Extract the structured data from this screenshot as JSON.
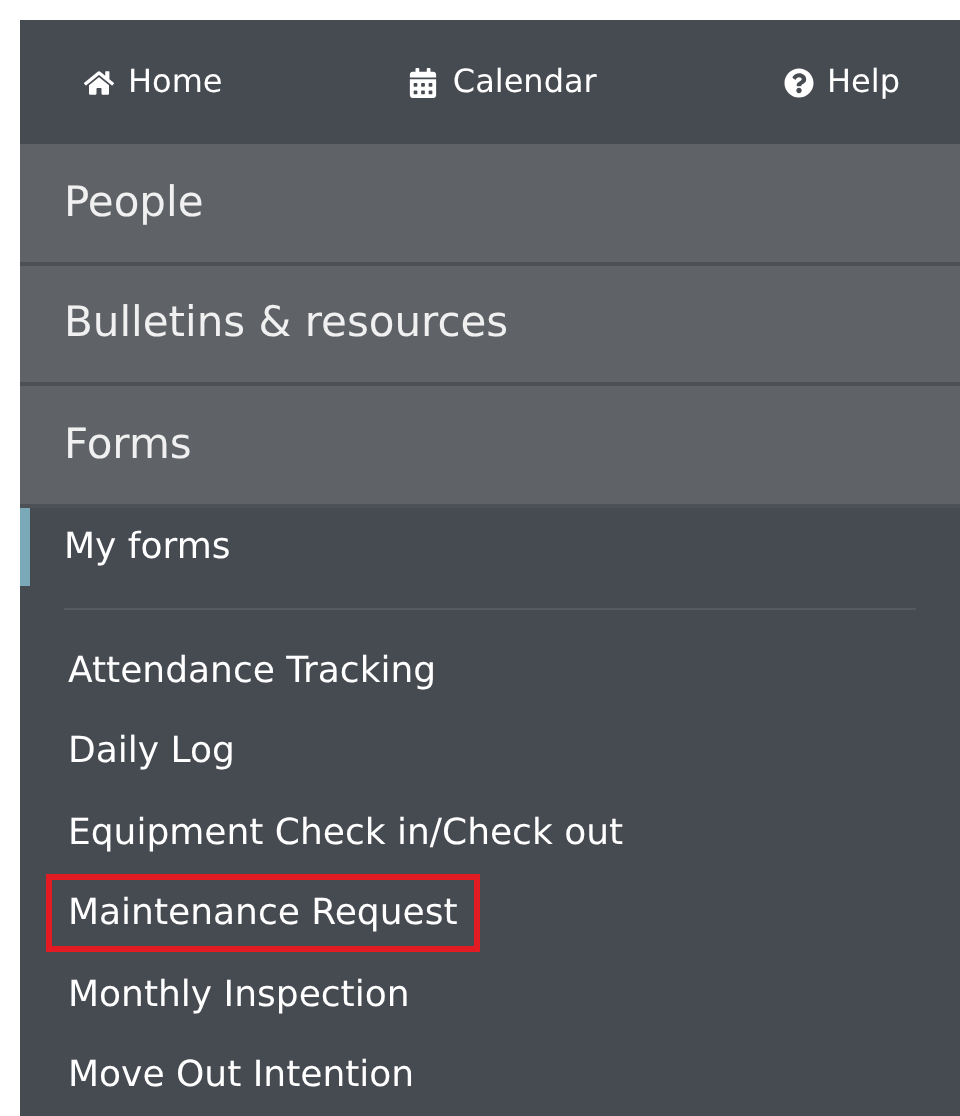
{
  "top_nav": [
    {
      "label": "Home"
    },
    {
      "label": "Calendar"
    },
    {
      "label": "Help"
    }
  ],
  "sections": [
    {
      "label": "People"
    },
    {
      "label": "Bulletins & resources"
    },
    {
      "label": "Forms"
    }
  ],
  "my_forms": {
    "label": "My forms",
    "selected": true
  },
  "forms": [
    {
      "label": "Attendance Tracking",
      "highlighted": false
    },
    {
      "label": "Daily Log",
      "highlighted": false
    },
    {
      "label": "Equipment Check in/Check out",
      "highlighted": false
    },
    {
      "label": "Maintenance Request",
      "highlighted": true
    },
    {
      "label": "Monthly Inspection",
      "highlighted": false
    },
    {
      "label": "Move Out Intention",
      "highlighted": false
    }
  ]
}
